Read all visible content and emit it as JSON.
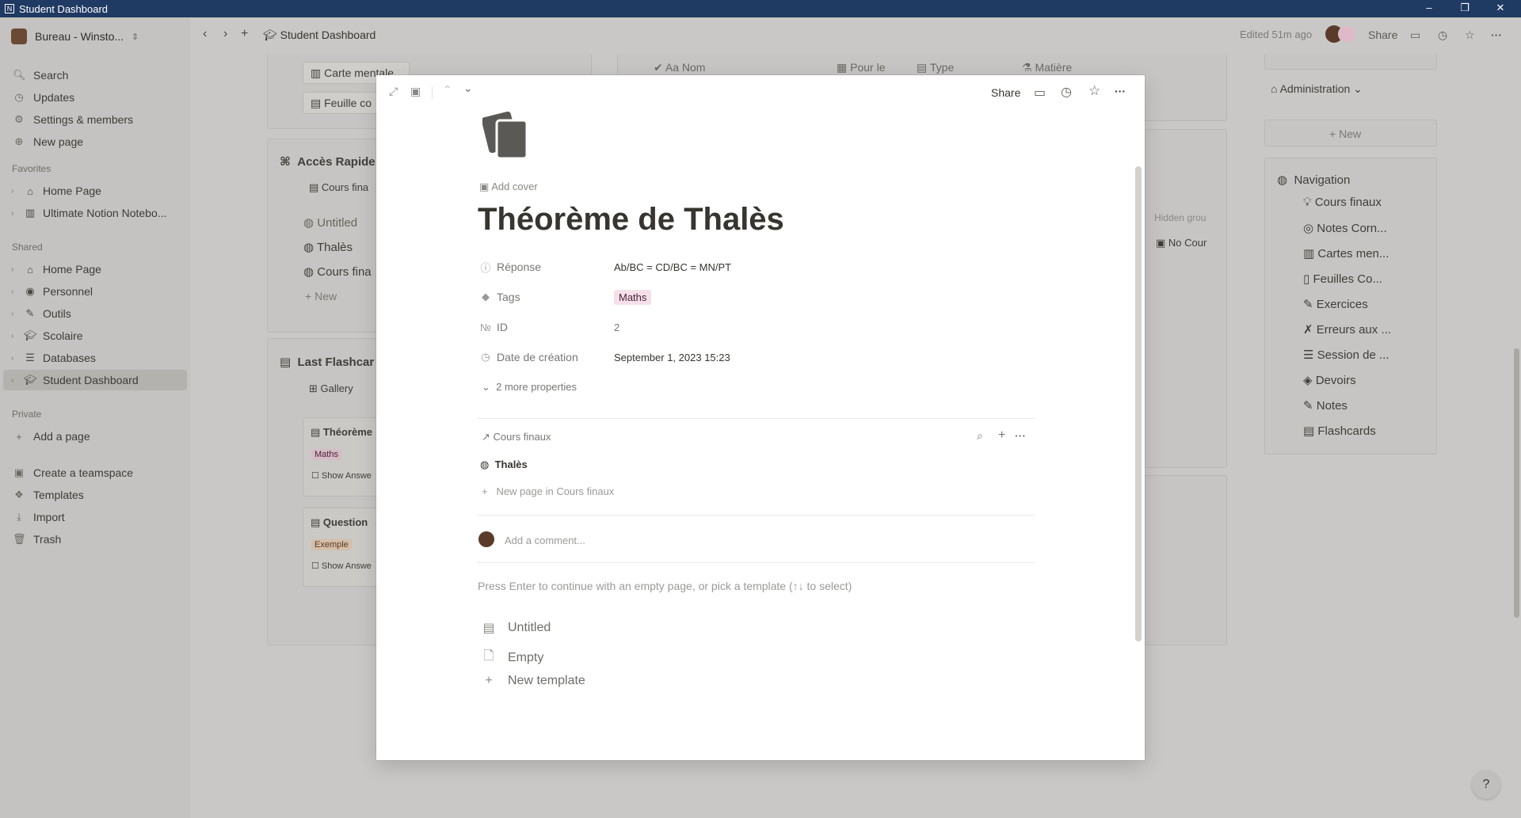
{
  "window": {
    "title": "Student Dashboard",
    "minimize": "–",
    "restore": "❐",
    "close": "✕"
  },
  "sidebar": {
    "workspace": "Bureau - Winsto...",
    "top": [
      {
        "label": "Search",
        "icon": "🔍︎"
      },
      {
        "label": "Updates",
        "icon": "◷"
      },
      {
        "label": "Settings & members",
        "icon": "⚙"
      },
      {
        "label": "New page",
        "icon": "⊕"
      }
    ],
    "favorites_title": "Favorites",
    "favorites": [
      {
        "label": "Home Page",
        "icon": "⌂"
      },
      {
        "label": "Ultimate Notion Notebo...",
        "icon": "▥"
      }
    ],
    "shared_title": "Shared",
    "shared": [
      {
        "label": "Home Page",
        "icon": "⌂"
      },
      {
        "label": "Personnel",
        "icon": "◉"
      },
      {
        "label": "Outils",
        "icon": "✎"
      },
      {
        "label": "Scolaire",
        "icon": "🎓︎"
      },
      {
        "label": "Databases",
        "icon": "☰"
      },
      {
        "label": "Student Dashboard",
        "icon": "🎓︎"
      }
    ],
    "private_title": "Private",
    "add_page": "Add a page",
    "bottom": [
      {
        "label": "Create a teamspace",
        "icon": "▣"
      },
      {
        "label": "Templates",
        "icon": "❖"
      },
      {
        "label": "Import",
        "icon": "⤓"
      },
      {
        "label": "Trash",
        "icon": "🗑︎"
      }
    ]
  },
  "topbar": {
    "breadcrumb": "Student Dashboard",
    "edited": "Edited 51m ago",
    "share": "Share"
  },
  "background": {
    "carte_mentale": "Carte mentale",
    "feuille": "Feuille co",
    "acces_rapide": "Accès Rapide",
    "cours_fina": "Cours fina",
    "untitled": "Untitled",
    "thales": "Thalès",
    "cours_fina2": "Cours fina",
    "new": "New",
    "last_flashcards": "Last Flashcar",
    "gallery": "Gallery",
    "card1_title": "Théorème",
    "card1_tag": "Maths",
    "card1_show": "Show Answe",
    "card2_title": "Question",
    "card2_tag": "Exemple",
    "card2_show": "Show Answe",
    "col_nom": "Aa Nom",
    "col_pour": "Pour le",
    "col_type": "Type",
    "col_matiere": "Matière",
    "hidden": "Hidden grou",
    "no_cour": "No Cour",
    "administration": "Administration",
    "new_btn": "New",
    "navigation_title": "Navigation",
    "navigation": [
      {
        "label": "Cours finaux",
        "icon": "💡︎"
      },
      {
        "label": "Notes Corn...",
        "icon": "◎"
      },
      {
        "label": "Cartes men...",
        "icon": "▥"
      },
      {
        "label": "Feuilles Co...",
        "icon": "▯"
      },
      {
        "label": "Exercices",
        "icon": "✎"
      },
      {
        "label": "Erreurs aux ...",
        "icon": "✗"
      },
      {
        "label": "Session de ...",
        "icon": "☰"
      },
      {
        "label": "Devoirs",
        "icon": "◈"
      },
      {
        "label": "Notes",
        "icon": "✎"
      },
      {
        "label": "Flashcards",
        "icon": "▤"
      }
    ]
  },
  "modal": {
    "share": "Share",
    "add_cover": "Add cover",
    "title": "Théorème de Thalès",
    "properties": [
      {
        "label": "Réponse",
        "value": "Ab/BC = CD/BC = MN/PT",
        "icon": "ⓘ"
      },
      {
        "label": "Tags",
        "value": "Maths",
        "icon": "◆"
      },
      {
        "label": "ID",
        "value": "2",
        "icon": "№"
      },
      {
        "label": "Date de création",
        "value": "September 1, 2023 15:23",
        "icon": "◷"
      }
    ],
    "more_properties": "2 more properties",
    "relation_title": "Cours finaux",
    "relation_item": "Thalès",
    "relation_new": "New page in Cours finaux",
    "comment_placeholder": "Add a comment...",
    "template_prompt": "Press Enter to continue with an empty page, or pick a template (↑↓ to select)",
    "templates": [
      {
        "label": "Untitled",
        "icon": "▤"
      },
      {
        "label": "Empty",
        "icon": "🗋︎"
      },
      {
        "label": "New template",
        "icon": "+"
      }
    ]
  },
  "help": "?"
}
